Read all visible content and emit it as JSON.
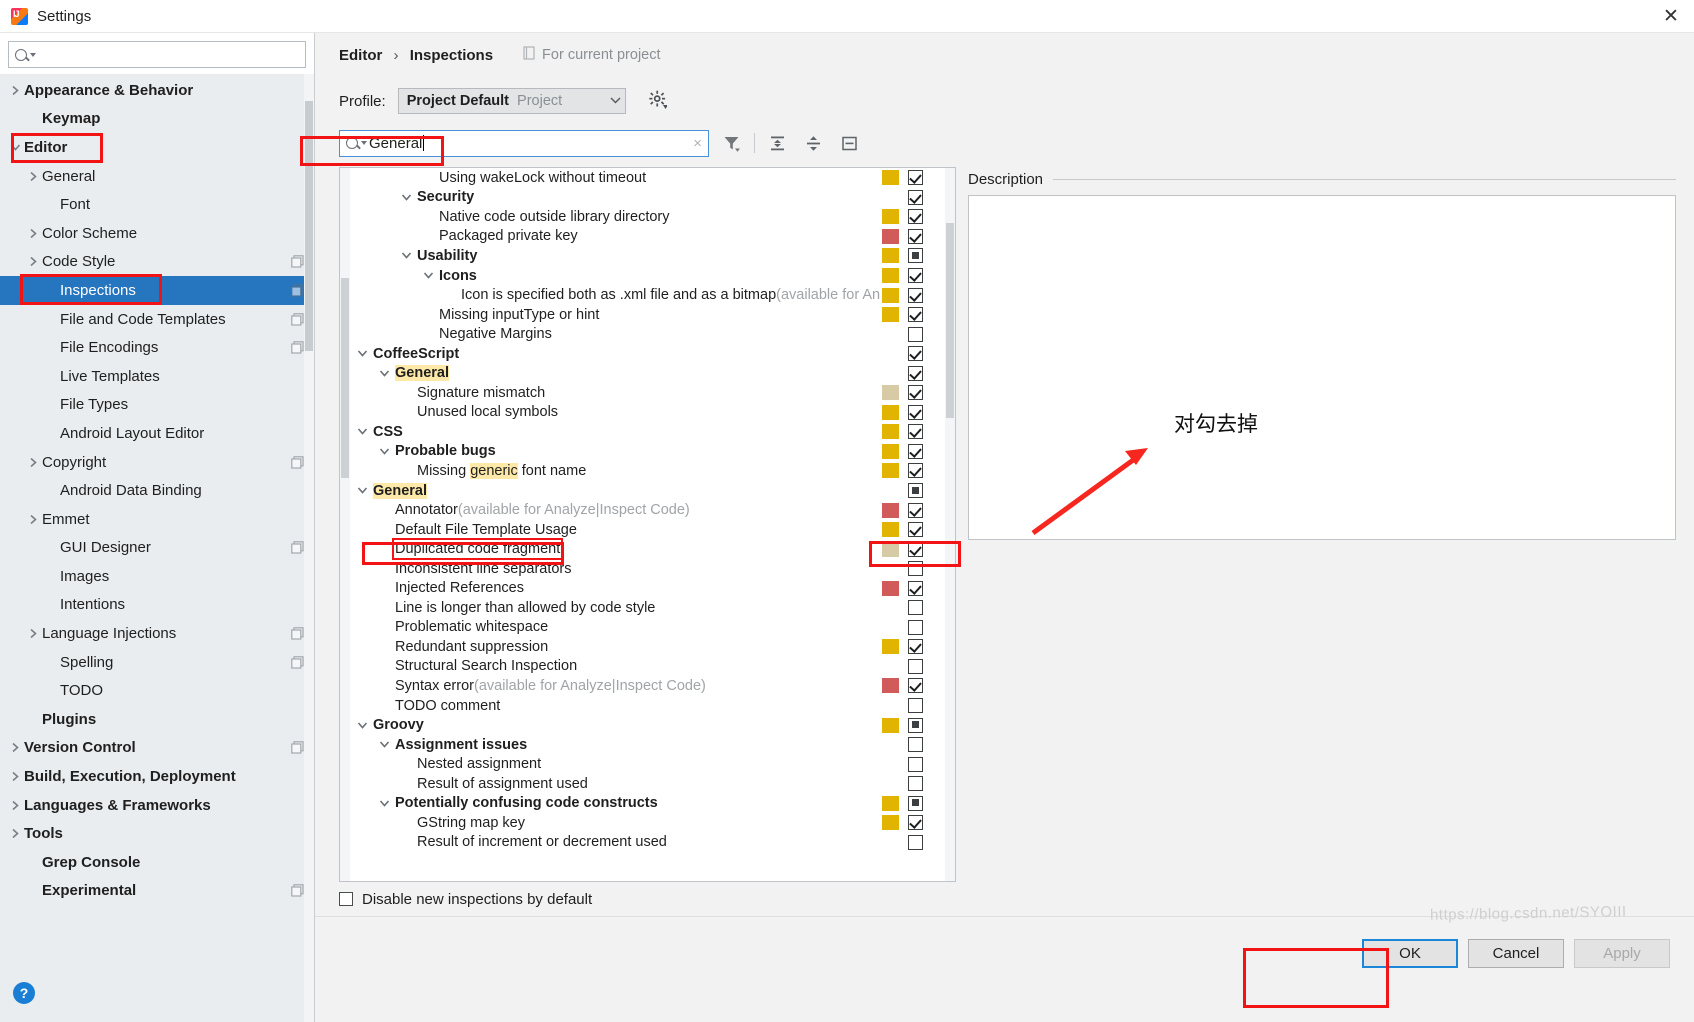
{
  "window": {
    "title": "Settings",
    "app_icon": "intellij-idea-icon",
    "close_label": "✕"
  },
  "sidebar": {
    "search_placeholder": "",
    "search_value": "",
    "items": [
      {
        "label": "Appearance & Behavior",
        "arrow": "right",
        "bold": true,
        "indent": 0,
        "badge": false,
        "selected": false
      },
      {
        "label": "Keymap",
        "arrow": "none",
        "bold": true,
        "indent": 1,
        "badge": false,
        "selected": false
      },
      {
        "label": "Editor",
        "arrow": "down",
        "bold": true,
        "indent": 0,
        "badge": false,
        "selected": false
      },
      {
        "label": "General",
        "arrow": "right",
        "bold": false,
        "indent": 1,
        "badge": false,
        "selected": false
      },
      {
        "label": "Font",
        "arrow": "none",
        "bold": false,
        "indent": 2,
        "badge": false,
        "selected": false
      },
      {
        "label": "Color Scheme",
        "arrow": "right",
        "bold": false,
        "indent": 1,
        "badge": false,
        "selected": false
      },
      {
        "label": "Code Style",
        "arrow": "right",
        "bold": false,
        "indent": 1,
        "badge": true,
        "selected": false
      },
      {
        "label": "Inspections",
        "arrow": "none",
        "bold": false,
        "indent": 2,
        "badge": true,
        "selected": true
      },
      {
        "label": "File and Code Templates",
        "arrow": "none",
        "bold": false,
        "indent": 2,
        "badge": true,
        "selected": false
      },
      {
        "label": "File Encodings",
        "arrow": "none",
        "bold": false,
        "indent": 2,
        "badge": true,
        "selected": false
      },
      {
        "label": "Live Templates",
        "arrow": "none",
        "bold": false,
        "indent": 2,
        "badge": false,
        "selected": false
      },
      {
        "label": "File Types",
        "arrow": "none",
        "bold": false,
        "indent": 2,
        "badge": false,
        "selected": false
      },
      {
        "label": "Android Layout Editor",
        "arrow": "none",
        "bold": false,
        "indent": 2,
        "badge": false,
        "selected": false
      },
      {
        "label": "Copyright",
        "arrow": "right",
        "bold": false,
        "indent": 1,
        "badge": true,
        "selected": false
      },
      {
        "label": "Android Data Binding",
        "arrow": "none",
        "bold": false,
        "indent": 2,
        "badge": false,
        "selected": false
      },
      {
        "label": "Emmet",
        "arrow": "right",
        "bold": false,
        "indent": 1,
        "badge": false,
        "selected": false
      },
      {
        "label": "GUI Designer",
        "arrow": "none",
        "bold": false,
        "indent": 2,
        "badge": true,
        "selected": false
      },
      {
        "label": "Images",
        "arrow": "none",
        "bold": false,
        "indent": 2,
        "badge": false,
        "selected": false
      },
      {
        "label": "Intentions",
        "arrow": "none",
        "bold": false,
        "indent": 2,
        "badge": false,
        "selected": false
      },
      {
        "label": "Language Injections",
        "arrow": "right",
        "bold": false,
        "indent": 1,
        "badge": true,
        "selected": false
      },
      {
        "label": "Spelling",
        "arrow": "none",
        "bold": false,
        "indent": 2,
        "badge": true,
        "selected": false
      },
      {
        "label": "TODO",
        "arrow": "none",
        "bold": false,
        "indent": 2,
        "badge": false,
        "selected": false
      },
      {
        "label": "Plugins",
        "arrow": "none",
        "bold": true,
        "indent": 1,
        "badge": false,
        "selected": false
      },
      {
        "label": "Version Control",
        "arrow": "right",
        "bold": true,
        "indent": 0,
        "badge": true,
        "selected": false
      },
      {
        "label": "Build, Execution, Deployment",
        "arrow": "right",
        "bold": true,
        "indent": 0,
        "badge": false,
        "selected": false
      },
      {
        "label": "Languages & Frameworks",
        "arrow": "right",
        "bold": true,
        "indent": 0,
        "badge": false,
        "selected": false
      },
      {
        "label": "Tools",
        "arrow": "right",
        "bold": true,
        "indent": 0,
        "badge": false,
        "selected": false
      },
      {
        "label": "Grep Console",
        "arrow": "none",
        "bold": true,
        "indent": 1,
        "badge": false,
        "selected": false
      },
      {
        "label": "Experimental",
        "arrow": "none",
        "bold": true,
        "indent": 1,
        "badge": true,
        "selected": false
      }
    ]
  },
  "header": {
    "breadcrumb_root": "Editor",
    "breadcrumb_sep": "›",
    "breadcrumb_leaf": "Inspections",
    "scope_note": "For current project",
    "profile_label": "Profile:",
    "profile_name": "Project Default",
    "profile_scope": "Project",
    "gear_icon": "gear-icon"
  },
  "filter_bar": {
    "search_value": "General",
    "clear_icon": "×",
    "filter_icon": "filter-icon",
    "expand_all_icon": "expand-all-icon",
    "collapse_all_icon": "collapse-all-icon",
    "reset_icon": "reset-icon"
  },
  "tree": {
    "rows": [
      {
        "text": "Using wakeLock without timeout",
        "indent": 3,
        "group": false,
        "toggle": "none",
        "swatch": "#e0b400",
        "check": "checked"
      },
      {
        "text": "Security",
        "indent": 2,
        "group": true,
        "toggle": "down",
        "swatch": "",
        "check": "checked"
      },
      {
        "text": "Native code outside library directory",
        "indent": 3,
        "group": false,
        "toggle": "none",
        "swatch": "#e0b400",
        "check": "checked"
      },
      {
        "text": "Packaged private key",
        "indent": 3,
        "group": false,
        "toggle": "none",
        "swatch": "#d15b5b",
        "check": "checked"
      },
      {
        "text": "Usability",
        "indent": 2,
        "group": true,
        "toggle": "down",
        "swatch": "#e0b400",
        "check": "partial"
      },
      {
        "text": "Icons",
        "indent": 3,
        "group": true,
        "toggle": "down",
        "swatch": "#e0b400",
        "check": "checked"
      },
      {
        "text": "Icon is specified both as .xml file and as a bitmap",
        "suffix": " (available for An",
        "indent": 4,
        "group": false,
        "toggle": "none",
        "swatch": "#e0b400",
        "check": "checked"
      },
      {
        "text": "Missing inputType or hint",
        "indent": 3,
        "group": false,
        "toggle": "none",
        "swatch": "#e0b400",
        "check": "checked"
      },
      {
        "text": "Negative Margins",
        "indent": 3,
        "group": false,
        "toggle": "none",
        "swatch": "",
        "check": "unchecked"
      },
      {
        "text": "CoffeeScript",
        "indent": 0,
        "group": true,
        "toggle": "down",
        "swatch": "",
        "check": "checked"
      },
      {
        "text": "General",
        "highlight": "General",
        "indent": 1,
        "group": true,
        "toggle": "down",
        "swatch": "",
        "check": "checked"
      },
      {
        "text": "Signature mismatch",
        "indent": 2,
        "group": false,
        "toggle": "none",
        "swatch": "#d7cba6",
        "check": "checked"
      },
      {
        "text": "Unused local symbols",
        "indent": 2,
        "group": false,
        "toggle": "none",
        "swatch": "#e0b400",
        "check": "checked"
      },
      {
        "text": "CSS",
        "indent": 0,
        "group": true,
        "toggle": "down",
        "swatch": "#e0b400",
        "check": "checked"
      },
      {
        "text": "Probable bugs",
        "indent": 1,
        "group": true,
        "toggle": "down",
        "swatch": "#e0b400",
        "check": "checked"
      },
      {
        "text": "Missing generic font name",
        "highlight": "generic",
        "indent": 2,
        "group": false,
        "toggle": "none",
        "swatch": "#e0b400",
        "check": "checked"
      },
      {
        "text": "General",
        "highlight": "General",
        "indent": 0,
        "group": true,
        "toggle": "down",
        "swatch": "",
        "check": "partial"
      },
      {
        "text": "Annotator",
        "suffix": " (available for Analyze|Inspect Code)",
        "indent": 1,
        "group": false,
        "toggle": "none",
        "swatch": "#d15b5b",
        "check": "checked"
      },
      {
        "text": "Default File Template Usage",
        "indent": 1,
        "group": false,
        "toggle": "none",
        "swatch": "#e0b400",
        "check": "checked"
      },
      {
        "text": "Duplicated code fragment",
        "boxed": true,
        "indent": 1,
        "group": false,
        "toggle": "none",
        "swatch": "#d7cba6",
        "check": "checked",
        "check_boxed": true
      },
      {
        "text": "Inconsistent line separators",
        "indent": 1,
        "group": false,
        "toggle": "none",
        "swatch": "",
        "check": "unchecked"
      },
      {
        "text": "Injected References",
        "indent": 1,
        "group": false,
        "toggle": "none",
        "swatch": "#d15b5b",
        "check": "checked"
      },
      {
        "text": "Line is longer than allowed by code style",
        "indent": 1,
        "group": false,
        "toggle": "none",
        "swatch": "",
        "check": "unchecked"
      },
      {
        "text": "Problematic whitespace",
        "indent": 1,
        "group": false,
        "toggle": "none",
        "swatch": "",
        "check": "unchecked"
      },
      {
        "text": "Redundant suppression",
        "indent": 1,
        "group": false,
        "toggle": "none",
        "swatch": "#e0b400",
        "check": "checked"
      },
      {
        "text": "Structural Search Inspection",
        "indent": 1,
        "group": false,
        "toggle": "none",
        "swatch": "",
        "check": "unchecked"
      },
      {
        "text": "Syntax error",
        "suffix": " (available for Analyze|Inspect Code)",
        "indent": 1,
        "group": false,
        "toggle": "none",
        "swatch": "#d15b5b",
        "check": "checked"
      },
      {
        "text": "TODO comment",
        "indent": 1,
        "group": false,
        "toggle": "none",
        "swatch": "",
        "check": "unchecked"
      },
      {
        "text": "Groovy",
        "indent": 0,
        "group": true,
        "toggle": "down",
        "swatch": "#e0b400",
        "check": "partial"
      },
      {
        "text": "Assignment issues",
        "indent": 1,
        "group": true,
        "toggle": "down",
        "swatch": "",
        "check": "unchecked"
      },
      {
        "text": "Nested assignment",
        "indent": 2,
        "group": false,
        "toggle": "none",
        "swatch": "",
        "check": "unchecked"
      },
      {
        "text": "Result of assignment used",
        "indent": 2,
        "group": false,
        "toggle": "none",
        "swatch": "",
        "check": "unchecked"
      },
      {
        "text": "Potentially confusing code constructs",
        "indent": 1,
        "group": true,
        "toggle": "down",
        "swatch": "#e0b400",
        "check": "partial"
      },
      {
        "text": "GString map key",
        "indent": 2,
        "group": false,
        "toggle": "none",
        "swatch": "#e0b400",
        "check": "checked"
      },
      {
        "text": "Result of increment or decrement used",
        "indent": 2,
        "group": false,
        "toggle": "none",
        "swatch": "",
        "check": "unchecked"
      }
    ]
  },
  "description": {
    "title": "Description",
    "body": ""
  },
  "footer": {
    "disable_checkbox_label": "Disable new inspections by default",
    "disable_checked": false,
    "ok_label": "OK",
    "cancel_label": "Cancel",
    "apply_label": "Apply",
    "help_label": "?"
  },
  "annotations": {
    "note_text": "对勾去掉",
    "box_color": "#f21414",
    "arrow_color": "#f7261e"
  },
  "watermark": "https://blog.csdn.net/SYOIII"
}
